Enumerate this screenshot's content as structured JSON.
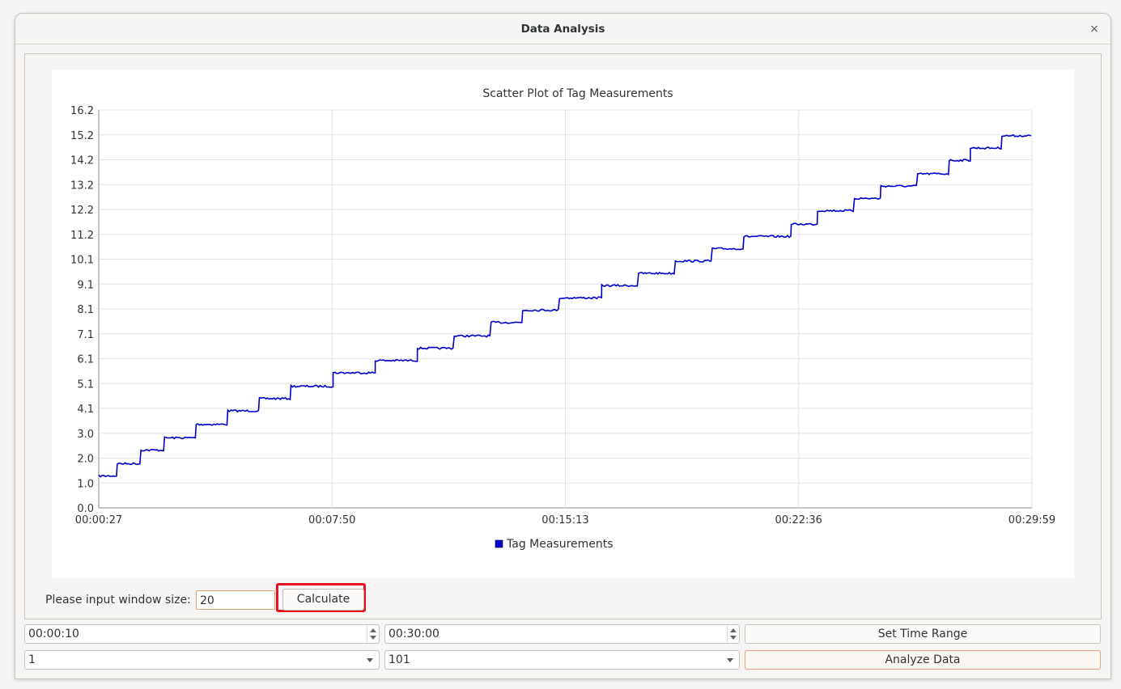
{
  "window": {
    "title": "Data Analysis",
    "close_icon": "×"
  },
  "chart_data": {
    "type": "scatter",
    "title": "Scatter Plot of Tag Measurements",
    "legend": "Tag Measurements",
    "legend_position": "bottom",
    "series_color": "#0000cc",
    "grid": true,
    "yticks": [
      "0.0",
      "1.0",
      "2.0",
      "3.0",
      "4.1",
      "5.1",
      "6.1",
      "7.1",
      "8.1",
      "9.1",
      "10.1",
      "11.2",
      "12.2",
      "13.2",
      "14.2",
      "15.2",
      "16.2"
    ],
    "ylim": [
      0.0,
      16.2
    ],
    "xticks": [
      "00:00:27",
      "00:07:50",
      "00:15:13",
      "00:22:36",
      "00:29:59"
    ],
    "xlim": [
      "00:00:27",
      "00:29:59"
    ],
    "steps": [
      {
        "start": "00:00:27",
        "value": 1.3
      },
      {
        "start": "00:01:02",
        "value": 1.8
      },
      {
        "start": "00:01:47",
        "value": 2.35
      },
      {
        "start": "00:02:32",
        "value": 2.85
      },
      {
        "start": "00:03:32",
        "value": 3.4
      },
      {
        "start": "00:04:32",
        "value": 3.95
      },
      {
        "start": "00:05:32",
        "value": 4.45
      },
      {
        "start": "00:06:32",
        "value": 4.95
      },
      {
        "start": "00:07:52",
        "value": 5.5
      },
      {
        "start": "00:09:12",
        "value": 6.0
      },
      {
        "start": "00:10:32",
        "value": 6.5
      },
      {
        "start": "00:11:42",
        "value": 7.0
      },
      {
        "start": "00:12:52",
        "value": 7.55
      },
      {
        "start": "00:13:52",
        "value": 8.05
      },
      {
        "start": "00:15:02",
        "value": 8.55
      },
      {
        "start": "00:16:22",
        "value": 9.05
      },
      {
        "start": "00:17:32",
        "value": 9.55
      },
      {
        "start": "00:18:42",
        "value": 10.05
      },
      {
        "start": "00:19:52",
        "value": 10.55
      },
      {
        "start": "00:20:52",
        "value": 11.05
      },
      {
        "start": "00:22:22",
        "value": 11.55
      },
      {
        "start": "00:23:12",
        "value": 12.1
      },
      {
        "start": "00:24:22",
        "value": 12.6
      },
      {
        "start": "00:25:12",
        "value": 13.1
      },
      {
        "start": "00:26:22",
        "value": 13.6
      },
      {
        "start": "00:27:22",
        "value": 14.15
      },
      {
        "start": "00:28:02",
        "value": 14.65
      },
      {
        "start": "00:29:02",
        "value": 15.15
      }
    ],
    "end": "00:29:59"
  },
  "controls": {
    "window_size_label": "Please input window size:",
    "window_size_value": "20",
    "calculate_label": "Calculate",
    "start_time": "00:00:10",
    "end_time": "00:30:00",
    "set_time_range_label": "Set Time Range",
    "combo1_value": "1",
    "combo2_value": "101",
    "analyze_label": "Analyze Data"
  }
}
